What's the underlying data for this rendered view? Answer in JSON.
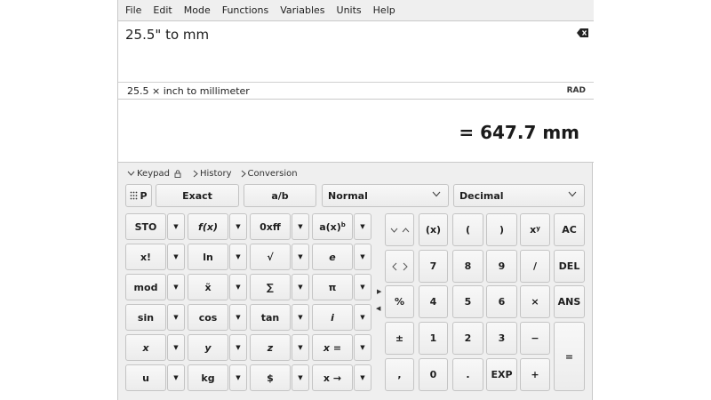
{
  "menu": [
    "File",
    "Edit",
    "Mode",
    "Functions",
    "Variables",
    "Units",
    "Help"
  ],
  "expression": {
    "value": "25.5\" to mm"
  },
  "parsed": "25.5 × inch to millimeter",
  "angle_mode": "RAD",
  "result": "= 647.7 mm",
  "tabs": {
    "keypad": "Keypad",
    "history": "History",
    "conversion": "Conversion"
  },
  "top_row": {
    "toggle": "P",
    "exact": "Exact",
    "fraction": "a/b",
    "display_mode": "Normal",
    "number_base": "Decimal"
  },
  "function_keys": [
    [
      "STO",
      "f(x)",
      "0xff",
      "a(x)"
    ],
    [
      "x!",
      "ln",
      "√",
      "e"
    ],
    [
      "mod",
      "x̃",
      "∑",
      "π"
    ],
    [
      "sin",
      "cos",
      "tan",
      "i"
    ],
    [
      "x",
      "y",
      "z",
      "x ="
    ],
    [
      "u",
      "kg",
      "$",
      "x →"
    ]
  ],
  "function_sup": "b",
  "numpad": {
    "rows": [
      [
        "(x)",
        "(",
        ")",
        "x",
        "AC"
      ],
      [
        "7",
        "8",
        "9",
        "/",
        "DEL"
      ],
      [
        "%",
        "4",
        "5",
        "6",
        "×",
        "ANS"
      ],
      [
        "±",
        "1",
        "2",
        "3",
        "−"
      ],
      [
        ",",
        "0",
        ".",
        "EXP",
        "+"
      ]
    ],
    "xy_sup": "y",
    "equals": "="
  },
  "colors": {
    "window_bg": "#efefef",
    "key_border": "#c4c4c4",
    "text": "#1e1e1e"
  }
}
